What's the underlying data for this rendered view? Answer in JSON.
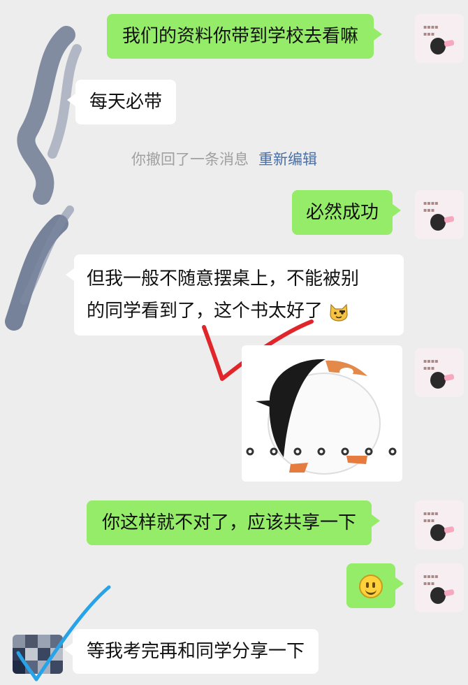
{
  "messages": [
    {
      "side": "sent",
      "text": "我们的资料你带到学校去看嘛"
    },
    {
      "side": "received",
      "text": "每天必带"
    },
    {
      "side": "system",
      "text": "你撤回了一条消息",
      "action": "重新编辑"
    },
    {
      "side": "sent",
      "text": "必然成功"
    },
    {
      "side": "received",
      "line1": "但我一般不随意摆桌上，不能被别",
      "line2": "的同学看到了，这个书太好了"
    },
    {
      "side": "sent",
      "type": "sticker",
      "sticker": "penguin"
    },
    {
      "side": "sent",
      "text": "你这样就不对了，应该共享一下"
    },
    {
      "side": "sent",
      "type": "emoji",
      "emoji": "smile-emoji"
    },
    {
      "side": "received",
      "text": "等我考完再和同学分享一下"
    }
  ],
  "colors": {
    "background": "#ededed",
    "sent_bubble": "#95ec69",
    "received_bubble": "#ffffff",
    "system_text": "#a0a0a0",
    "link": "#4a6fa5",
    "red_check": "#e0262a",
    "blue_check": "#27a3e8"
  }
}
